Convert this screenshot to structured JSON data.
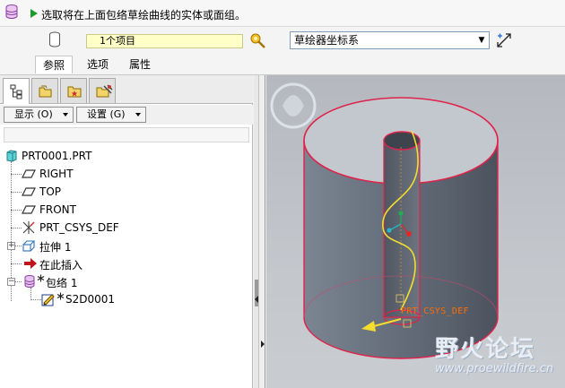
{
  "dashboard": {
    "prompt": "选取将在上面包络草绘曲线的实体或面组。",
    "selection_value": "1个项目",
    "direction_combo": "草绘器坐标系",
    "tabs": [
      {
        "label": "参照",
        "active": true
      },
      {
        "label": "选项",
        "active": false
      },
      {
        "label": "属性",
        "active": false
      }
    ]
  },
  "navigator": {
    "tabs": [
      "model-tree-icon",
      "folder-layers-icon",
      "favorites-folder-icon",
      "connections-icon"
    ],
    "show_button": "显示 (O)",
    "settings_button": "设置 (G)",
    "tree": [
      {
        "label": "PRT0001.PRT",
        "icon": "part-icon",
        "level": 0
      },
      {
        "label": "RIGHT",
        "icon": "datum-plane-icon",
        "level": 1
      },
      {
        "label": "TOP",
        "icon": "datum-plane-icon",
        "level": 1
      },
      {
        "label": "FRONT",
        "icon": "datum-plane-icon",
        "level": 1
      },
      {
        "label": "PRT_CSYS_DEF",
        "icon": "csys-icon",
        "level": 1
      },
      {
        "label": "拉伸 1",
        "icon": "extrude-icon",
        "level": 1,
        "expandable": true
      },
      {
        "label": "在此插入",
        "icon": "insert-here-icon",
        "level": 1
      },
      {
        "label": "包络 1",
        "icon": "wrap-icon",
        "level": 1,
        "expandable": true,
        "expanded": true
      },
      {
        "label": "S2D0001",
        "icon": "sketch-icon",
        "level": 2
      }
    ]
  },
  "graphics": {
    "csys_label": "PRT_CSYS_DEF",
    "watermark_title": "野火论坛",
    "watermark_url": "www.proewildfire.cn"
  },
  "colors": {
    "model_fill": "#5e6673",
    "model_edge": "#e0234a",
    "sketch_curve": "#f5dd2e",
    "prompt_arrow": "#1e9a2c",
    "selection_box": "#ffffc8"
  }
}
